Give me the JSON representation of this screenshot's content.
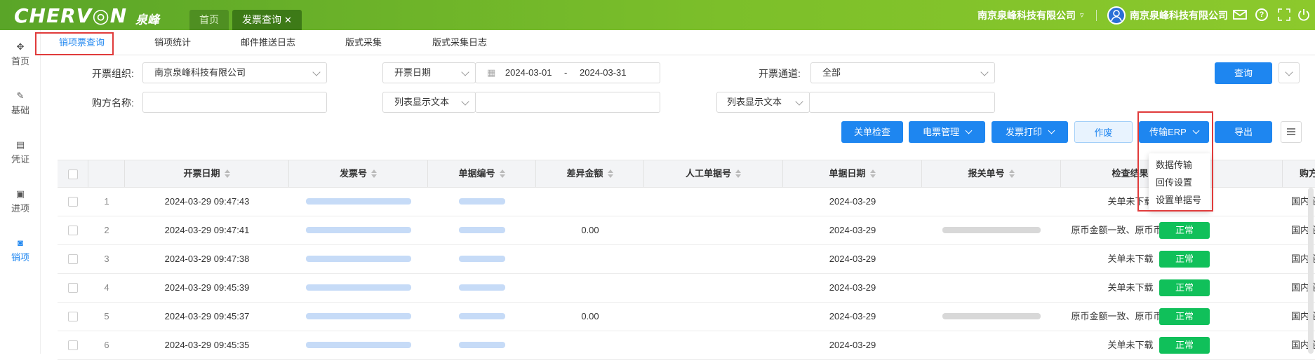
{
  "brand": {
    "logo": "CHERV◎N",
    "logo_cn": "泉峰",
    "accent": "#1e86f0",
    "header_green": "#6db52a"
  },
  "top_tabs": [
    {
      "label": "首页"
    },
    {
      "label": "发票查询",
      "close": "✕"
    }
  ],
  "header_right": {
    "company": "南京泉峰科技有限公司",
    "user": "南京泉峰科技有限公司"
  },
  "sidebar": [
    {
      "label": "首页",
      "icon": "grid-icon"
    },
    {
      "label": "基础",
      "icon": "pen-icon"
    },
    {
      "label": "凭证",
      "icon": "voucher-icon"
    },
    {
      "label": "进项",
      "icon": "ticket-icon"
    },
    {
      "label": "销项",
      "icon": "box-icon"
    }
  ],
  "sub_tabs": [
    {
      "label": "销项票查询"
    },
    {
      "label": "销项统计"
    },
    {
      "label": "邮件推送日志"
    },
    {
      "label": "版式采集"
    },
    {
      "label": "版式采集日志"
    }
  ],
  "filters": {
    "org_label": "开票组织:",
    "org_value": "南京泉峰科技有限公司",
    "date_type": "开票日期",
    "date_start": "2024-03-01",
    "date_sep": "-",
    "date_end": "2024-03-31",
    "channel_label": "开票通道:",
    "channel_value": "全部",
    "buyer_label": "购方名称:",
    "buyer_value": "",
    "list_text_1": "列表显示文本",
    "list_text_1_value": "",
    "list_text_2": "列表显示文本",
    "list_text_2_value": "",
    "query_button": "查询"
  },
  "actions": {
    "check": "关单检查",
    "e_manage": "电票管理",
    "print": "发票打印",
    "void": "作废",
    "erp": "传输ERP",
    "export": "导出"
  },
  "erp_menu": [
    "数据传输",
    "回传设置",
    "设置单据号"
  ],
  "columns": [
    "开票日期",
    "发票号",
    "单据编号",
    "差异金额",
    "人工单据号",
    "单据日期",
    "报关单号",
    "检查结果",
    "",
    "购方性质"
  ],
  "rows": [
    {
      "no": "1",
      "date": "2024-03-29 09:47:43",
      "diff": "",
      "bill_date": "2024-03-29",
      "customs": false,
      "result": "关单未下载",
      "status": "正常",
      "buyer_type": "国内企业"
    },
    {
      "no": "2",
      "date": "2024-03-29 09:47:41",
      "diff": "0.00",
      "bill_date": "2024-03-29",
      "customs": true,
      "result": "原币金额一致、原币币别一致",
      "status": "正常",
      "buyer_type": "国内企业"
    },
    {
      "no": "3",
      "date": "2024-03-29 09:47:38",
      "diff": "",
      "bill_date": "2024-03-29",
      "customs": false,
      "result": "关单未下载",
      "status": "正常",
      "buyer_type": "国内企业"
    },
    {
      "no": "4",
      "date": "2024-03-29 09:45:39",
      "diff": "",
      "bill_date": "2024-03-29",
      "customs": false,
      "result": "关单未下载",
      "status": "正常",
      "buyer_type": "国内企业"
    },
    {
      "no": "5",
      "date": "2024-03-29 09:45:37",
      "diff": "0.00",
      "bill_date": "2024-03-29",
      "customs": true,
      "result": "原币金额一致、原币币别一致",
      "status": "正常",
      "buyer_type": "国内企业"
    },
    {
      "no": "6",
      "date": "2024-03-29 09:45:35",
      "diff": "",
      "bill_date": "2024-03-29",
      "customs": false,
      "result": "关单未下载",
      "status": "正常",
      "buyer_type": "国内企业"
    }
  ]
}
